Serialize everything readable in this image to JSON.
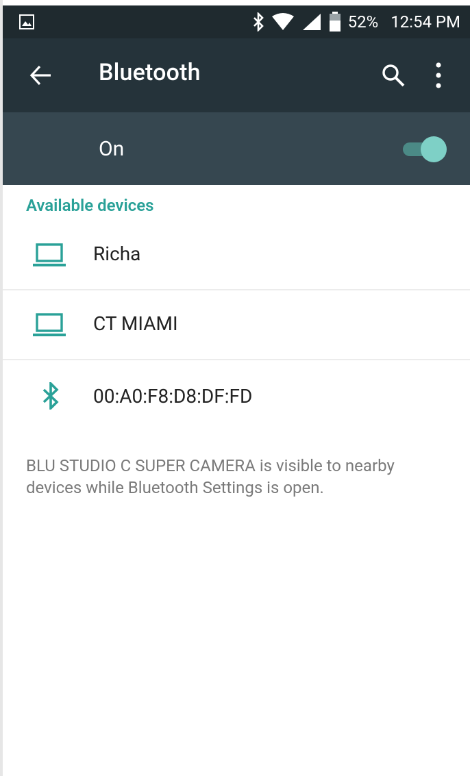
{
  "status_bar": {
    "battery": "52%",
    "time": "12:54 PM"
  },
  "app_bar": {
    "title": "Bluetooth"
  },
  "toggle": {
    "label": "On",
    "state": "on",
    "accent": "#7ed0c6"
  },
  "available_devices": {
    "header": "Available devices",
    "items": [
      {
        "name": "Richa",
        "icon": "laptop-icon"
      },
      {
        "name": "CT MIAMI",
        "icon": "laptop-icon"
      },
      {
        "name": "00:A0:F8:D8:DF:FD",
        "icon": "bluetooth-icon"
      }
    ]
  },
  "info": {
    "text": "BLU STUDIO C SUPER CAMERA is visible to nearby devices while Bluetooth Settings is open."
  },
  "colors": {
    "status_bar": "#1f2a2f",
    "app_bar": "#25333a",
    "toggle_bar": "#364750",
    "accent": "#2aa198"
  }
}
